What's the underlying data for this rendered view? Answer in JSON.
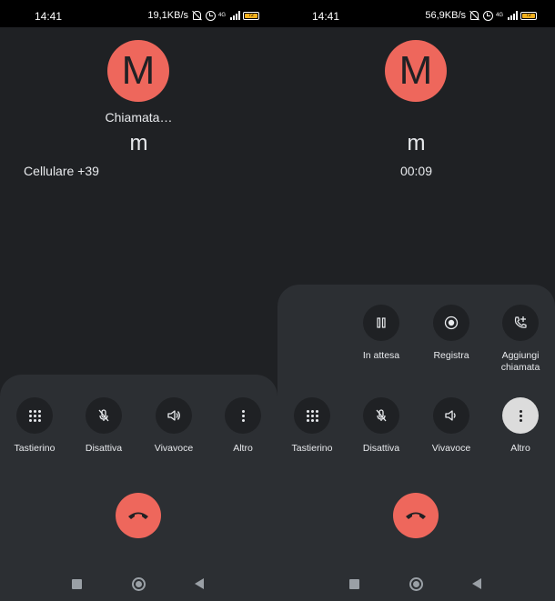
{
  "left": {
    "status_bar": {
      "time": "14:41",
      "speed": "19,1KB/s",
      "network": "4G",
      "battery": "72"
    },
    "avatar_letter": "M",
    "call_status": "Chiamata…",
    "caller_name": "m",
    "caller_detail": "Cellulare +39",
    "controls": [
      {
        "label": "Tastierino",
        "icon": "dialpad-icon"
      },
      {
        "label": "Disattiva",
        "icon": "mic-off-icon"
      },
      {
        "label": "Vivavoce",
        "icon": "speaker-icon"
      },
      {
        "label": "Altro",
        "icon": "more-icon"
      }
    ]
  },
  "right": {
    "status_bar": {
      "time": "14:41",
      "speed": "56,9KB/s",
      "network": "4G",
      "battery": "72"
    },
    "avatar_letter": "M",
    "caller_name": "m",
    "call_timer": "00:09",
    "extra_controls": [
      {
        "label": "In attesa",
        "icon": "pause-icon"
      },
      {
        "label": "Registra",
        "icon": "record-icon"
      },
      {
        "label": "Aggiungi chiamata",
        "icon": "add-call-icon"
      }
    ],
    "controls": [
      {
        "label": "Tastierino",
        "icon": "dialpad-icon"
      },
      {
        "label": "Disattiva",
        "icon": "mic-off-icon"
      },
      {
        "label": "Vivavoce",
        "icon": "speaker-icon"
      },
      {
        "label": "Altro",
        "icon": "more-icon",
        "active": true
      }
    ]
  },
  "colors": {
    "avatar": "#ee675c",
    "hangup": "#ee675c",
    "background": "#1f2124",
    "panel": "#2c2f33",
    "battery": "#f2b01e"
  }
}
